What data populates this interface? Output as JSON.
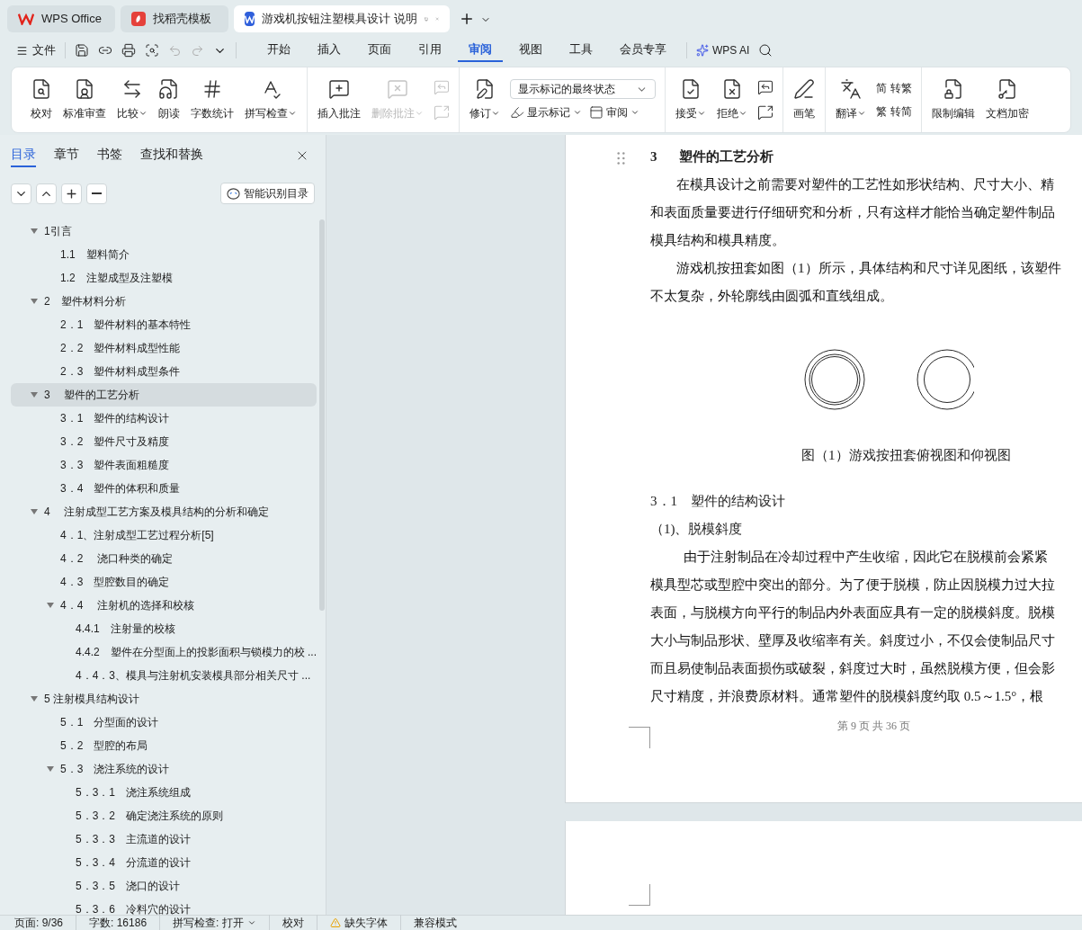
{
  "browser_tabs": [
    {
      "label": "WPS Office",
      "kind": "wps",
      "selected": false
    },
    {
      "label": "找稻壳模板",
      "kind": "docer",
      "selected": false
    },
    {
      "label": "游戏机按钮注塑模具设计 说明",
      "kind": "writer",
      "selected": true
    }
  ],
  "file_menu": "文件",
  "menu_tabs": [
    {
      "label": "开始",
      "selected": false
    },
    {
      "label": "插入",
      "selected": false
    },
    {
      "label": "页面",
      "selected": false
    },
    {
      "label": "引用",
      "selected": false
    },
    {
      "label": "审阅",
      "selected": true
    },
    {
      "label": "视图",
      "selected": false
    },
    {
      "label": "工具",
      "selected": false
    },
    {
      "label": "会员专享",
      "selected": false
    }
  ],
  "ai_button": "WPS AI",
  "ribbon_groups": [
    [
      {
        "kind": "large",
        "label": "校对",
        "dropdown": false,
        "disabled": false
      },
      {
        "kind": "large",
        "label": "标准审查",
        "dropdown": false,
        "disabled": false
      },
      {
        "kind": "large",
        "label": "比较",
        "dropdown": true,
        "disabled": false
      },
      {
        "kind": "large",
        "label": "朗读",
        "dropdown": false,
        "disabled": false
      },
      {
        "kind": "large",
        "label": "字数统计",
        "dropdown": false,
        "disabled": false
      },
      {
        "kind": "large",
        "label": "拼写检查",
        "dropdown": true,
        "disabled": false
      }
    ],
    [
      {
        "kind": "large",
        "label": "插入批注",
        "dropdown": false,
        "disabled": false
      },
      {
        "kind": "large",
        "label": "删除批注",
        "dropdown": true,
        "disabled": true
      },
      {
        "kind": "iconstack",
        "disabled": true
      }
    ],
    [
      {
        "kind": "large",
        "label": "修订",
        "dropdown": true,
        "disabled": false
      },
      {
        "kind": "markup",
        "select": "显示标记的最终状态",
        "items": [
          {
            "label": "显示标记"
          },
          {
            "label": "审阅"
          }
        ]
      }
    ],
    [
      {
        "kind": "large",
        "label": "接受",
        "dropdown": true,
        "disabled": false
      },
      {
        "kind": "large",
        "label": "拒绝",
        "dropdown": true,
        "disabled": false
      },
      {
        "kind": "iconstack",
        "disabled": false
      }
    ],
    [
      {
        "kind": "large",
        "label": "画笔",
        "dropdown": false,
        "disabled": false
      }
    ],
    [
      {
        "kind": "large",
        "label": "翻译",
        "dropdown": true,
        "disabled": false
      },
      {
        "kind": "convert",
        "items": [
          {
            "glyph": "简",
            "label": "转繁"
          },
          {
            "glyph": "繁",
            "label": "转简"
          }
        ]
      }
    ],
    [
      {
        "kind": "large",
        "label": "限制编辑",
        "dropdown": false,
        "disabled": false
      },
      {
        "kind": "large",
        "label": "文档加密",
        "dropdown": false,
        "disabled": false
      }
    ]
  ],
  "sidebar": {
    "tabs": [
      {
        "label": "目录",
        "selected": true
      },
      {
        "label": "章节",
        "selected": false
      },
      {
        "label": "书签",
        "selected": false
      },
      {
        "label": "查找和替换",
        "selected": false
      }
    ],
    "smart_button": "智能识别目录",
    "toc": [
      {
        "label": "1引言",
        "selected": false,
        "expanded": true,
        "children": [
          {
            "label": "1.1　塑料简介",
            "selected": false
          },
          {
            "label": "1.2　注塑成型及注塑模",
            "selected": false
          }
        ]
      },
      {
        "label": "2　塑件材料分析",
        "selected": false,
        "expanded": true,
        "children": [
          {
            "label": "2．1　塑件材料的基本特性",
            "selected": false
          },
          {
            "label": "2．2　塑件材料成型性能",
            "selected": false
          },
          {
            "label": "2．3　塑件材料成型条件",
            "selected": false
          }
        ]
      },
      {
        "label": "3　 塑件的工艺分析",
        "selected": true,
        "expanded": true,
        "children": [
          {
            "label": " 3．1　塑件的结构设计",
            "selected": false
          },
          {
            "label": "3．2　塑件尺寸及精度",
            "selected": false
          },
          {
            "label": "3．3　塑件表面粗糙度",
            "selected": false
          },
          {
            "label": "3．4　塑件的体积和质量",
            "selected": false
          }
        ]
      },
      {
        "label": "4　 注射成型工艺方案及模具结构的分析和确定",
        "selected": false,
        "expanded": true,
        "children": [
          {
            "label": "4．1、注射成型工艺过程分析[5]",
            "selected": false
          },
          {
            "label": "4．2　 浇口种类的确定",
            "selected": false
          },
          {
            "label": "4．3　型腔数目的确定",
            "selected": false
          },
          {
            "label": "4．4　 注射机的选择和校核",
            "selected": false,
            "expanded": true,
            "children": [
              {
                "label": "4.4.1　注射量的校核",
                "selected": false
              },
              {
                "label": "4.4.2　塑件在分型面上的投影面积与锁模力的校 ...",
                "selected": false
              },
              {
                "label": "4．4．3、模具与注射机安装模具部分相关尺寸 ...",
                "selected": false
              }
            ]
          }
        ]
      },
      {
        "label": "5 注射模具结构设计",
        "selected": false,
        "expanded": true,
        "children": [
          {
            "label": "5．1　分型面的设计",
            "selected": false
          },
          {
            "label": "5．2　型腔的布局",
            "selected": false
          },
          {
            "label": "5．3　浇注系统的设计",
            "selected": false,
            "expanded": true,
            "children": [
              {
                "label": "5．3．1　浇注系统组成",
                "selected": false
              },
              {
                "label": "5．3．2　确定浇注系统的原则",
                "selected": false
              },
              {
                "label": "5．3．3　主流道的设计",
                "selected": false
              },
              {
                "label": "5．3．4　分流道的设计",
                "selected": false
              },
              {
                "label": "5．3．5　浇口的设计",
                "selected": false
              },
              {
                "label": "5．3．6　冷料穴的设计",
                "selected": false
              }
            ]
          }
        ]
      }
    ]
  },
  "document": {
    "blocks": [
      {
        "kind": "heading",
        "number": "3",
        "text": "塑件的工艺分析"
      },
      {
        "kind": "para",
        "lines": [
          "在模具设计之前需要对塑件的工艺性如形状结构、尺寸大小、精",
          "和表面质量要进行仔细研究和分析，只有这样才能恰当确定塑件制品",
          "模具结构和模具精度。"
        ]
      },
      {
        "kind": "para",
        "lines": [
          "游戏机按扭套如图（1）所示，具体结构和尺寸详见图纸，该塑件",
          "不太复杂，外轮廓线由圆弧和直线组成。"
        ]
      },
      {
        "kind": "figure",
        "caption": "图（1）游戏按扭套俯视图和仰视图"
      },
      {
        "kind": "subheading",
        "text": "3．1　塑件的结构设计"
      },
      {
        "kind": "subheading",
        "text": "（1)、脱模斜度"
      },
      {
        "kind": "para",
        "lines": [
          "  由于注射制品在冷却过程中产生收缩，因此它在脱模前会紧紧",
          "模具型芯或型腔中突出的部分。为了便于脱模，防止因脱模力过大拉",
          "表面，与脱模方向平行的制品内外表面应具有一定的脱模斜度。脱模",
          "大小与制品形状、壁厚及收缩率有关。斜度过小，不仅会使制品尺寸",
          "而且易使制品表面损伤或破裂，斜度过大时，虽然脱模方便，但会影",
          "尺寸精度，并浪费原材料。通常塑件的脱模斜度约取 0.5～1.5°，根"
        ]
      }
    ],
    "page_footer": "第 9 页 共 36 页"
  },
  "status_bar": [
    {
      "kind": "text",
      "label": "页面: 9/36"
    },
    {
      "kind": "text",
      "label": "字数: 16186"
    },
    {
      "kind": "dropdown",
      "label": "拼写检查: 打开"
    },
    {
      "kind": "button",
      "label": "校对"
    },
    {
      "kind": "warning",
      "label": "缺失字体"
    },
    {
      "kind": "text",
      "label": "兼容模式"
    }
  ]
}
